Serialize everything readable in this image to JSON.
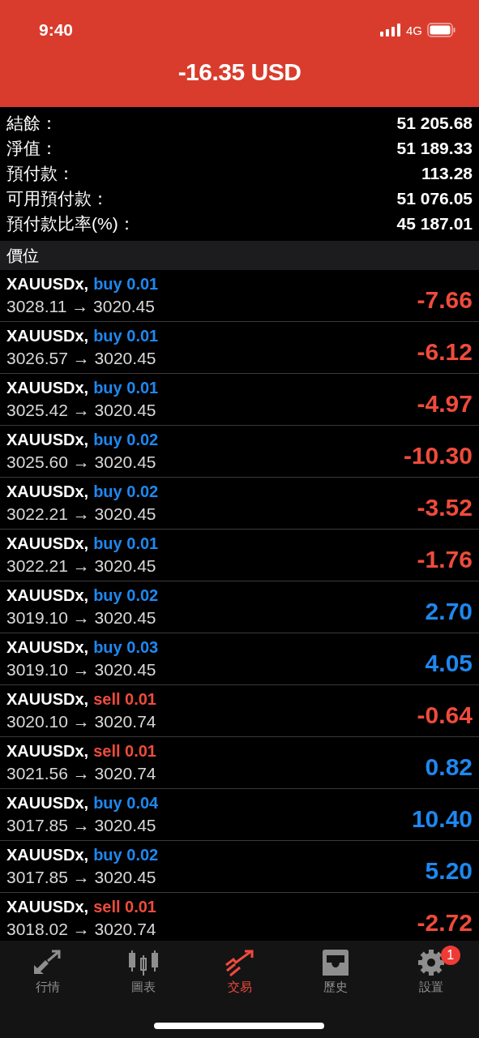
{
  "status_bar": {
    "time": "9:40",
    "network": "4G"
  },
  "header": {
    "title": "-16.35 USD"
  },
  "summary": [
    {
      "label": "結餘：",
      "value": "51 205.68"
    },
    {
      "label": "淨值：",
      "value": "51 189.33"
    },
    {
      "label": "預付款：",
      "value": "113.28"
    },
    {
      "label": "可用預付款：",
      "value": "51 076.05"
    },
    {
      "label": "預付款比率(%)：",
      "value": "45 187.01"
    }
  ],
  "section_title": "價位",
  "positions": [
    {
      "symbol": "XAUUSDx,",
      "kind": "buy",
      "order": "buy 0.01",
      "prices": "3028.11 → 3020.45",
      "profit": "-7.66",
      "color": "#ef4b3c"
    },
    {
      "symbol": "XAUUSDx,",
      "kind": "buy",
      "order": "buy 0.01",
      "prices": "3026.57 → 3020.45",
      "profit": "-6.12",
      "color": "#ef4b3c"
    },
    {
      "symbol": "XAUUSDx,",
      "kind": "buy",
      "order": "buy 0.01",
      "prices": "3025.42 → 3020.45",
      "profit": "-4.97",
      "color": "#ef4b3c"
    },
    {
      "symbol": "XAUUSDx,",
      "kind": "buy",
      "order": "buy 0.02",
      "prices": "3025.60 → 3020.45",
      "profit": "-10.30",
      "color": "#ef4b3c"
    },
    {
      "symbol": "XAUUSDx,",
      "kind": "buy",
      "order": "buy 0.02",
      "prices": "3022.21 → 3020.45",
      "profit": "-3.52",
      "color": "#ef4b3c"
    },
    {
      "symbol": "XAUUSDx,",
      "kind": "buy",
      "order": "buy 0.01",
      "prices": "3022.21 → 3020.45",
      "profit": "-1.76",
      "color": "#ef4b3c"
    },
    {
      "symbol": "XAUUSDx,",
      "kind": "buy",
      "order": "buy 0.02",
      "prices": "3019.10 → 3020.45",
      "profit": "2.70",
      "color": "#1e88f0"
    },
    {
      "symbol": "XAUUSDx,",
      "kind": "buy",
      "order": "buy 0.03",
      "prices": "3019.10 → 3020.45",
      "profit": "4.05",
      "color": "#1e88f0"
    },
    {
      "symbol": "XAUUSDx,",
      "kind": "sell",
      "order": "sell 0.01",
      "prices": "3020.10 → 3020.74",
      "profit": "-0.64",
      "color": "#ef4b3c"
    },
    {
      "symbol": "XAUUSDx,",
      "kind": "sell",
      "order": "sell 0.01",
      "prices": "3021.56 → 3020.74",
      "profit": "0.82",
      "color": "#1e88f0"
    },
    {
      "symbol": "XAUUSDx,",
      "kind": "buy",
      "order": "buy 0.04",
      "prices": "3017.85 → 3020.45",
      "profit": "10.40",
      "color": "#1e88f0"
    },
    {
      "symbol": "XAUUSDx,",
      "kind": "buy",
      "order": "buy 0.02",
      "prices": "3017.85 → 3020.45",
      "profit": "5.20",
      "color": "#1e88f0"
    },
    {
      "symbol": "XAUUSDx,",
      "kind": "sell",
      "order": "sell 0.01",
      "prices": "3018.02 → 3020.74",
      "profit": "-2.72",
      "color": "#ef4b3c"
    }
  ],
  "tabs": [
    {
      "label": "行情",
      "kind": "quotes",
      "selected": false
    },
    {
      "label": "圖表",
      "kind": "chart",
      "selected": false
    },
    {
      "label": "交易",
      "kind": "trade",
      "selected": true
    },
    {
      "label": "歷史",
      "kind": "history",
      "selected": false
    },
    {
      "label": "設置",
      "kind": "settings",
      "selected": false,
      "badge": "1"
    }
  ]
}
